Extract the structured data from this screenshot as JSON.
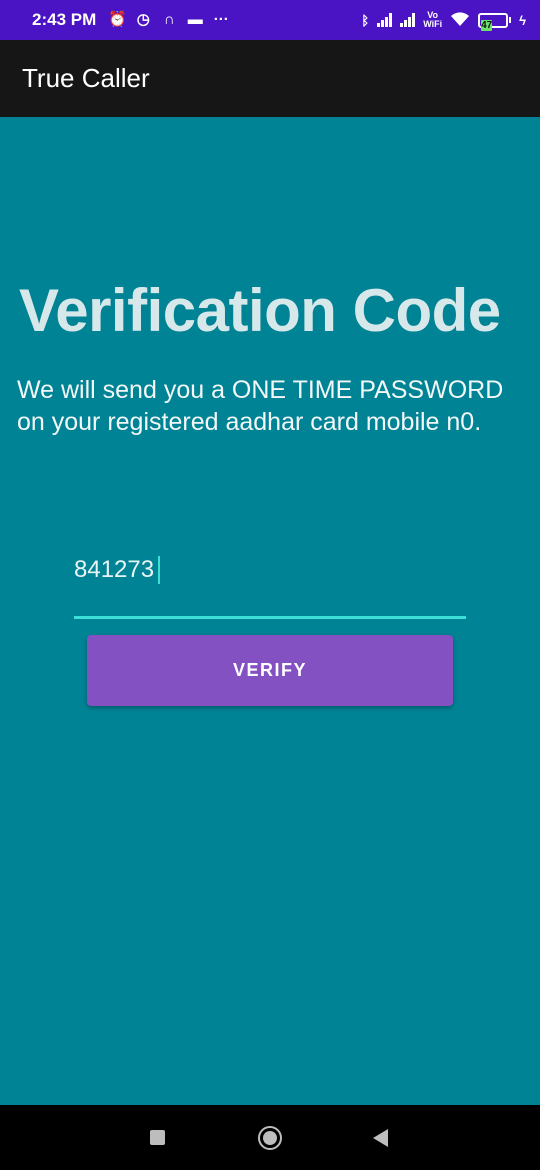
{
  "status_bar": {
    "time": "2:43 PM",
    "left_icons": [
      "alarm-off-icon",
      "alarm-clock-icon",
      "headset-icon",
      "message-icon",
      "more-dots-icon"
    ],
    "right_icons": [
      "bluetooth-icon",
      "signal-icon",
      "signal-icon",
      "vowifi-icon",
      "wifi-icon",
      "battery-icon",
      "charging-icon"
    ],
    "vowifi_top": "Vo",
    "vowifi_bottom": "WiFi",
    "battery_level": "47"
  },
  "app_bar": {
    "title": "True Caller"
  },
  "main": {
    "heading": "Verification Code",
    "description": "We will send you a ONE TIME PASSWORD on your registered aadhar card mobile n0.",
    "otp_value": "841273",
    "verify_label": "VERIFY"
  },
  "nav_bar": {
    "buttons": [
      "recents-button",
      "home-button",
      "back-button"
    ]
  },
  "colors": {
    "status_bar": "#4a14c4",
    "app_bar": "#161616",
    "background": "#008394",
    "accent": "#3de0d6",
    "button": "#8451c2"
  }
}
